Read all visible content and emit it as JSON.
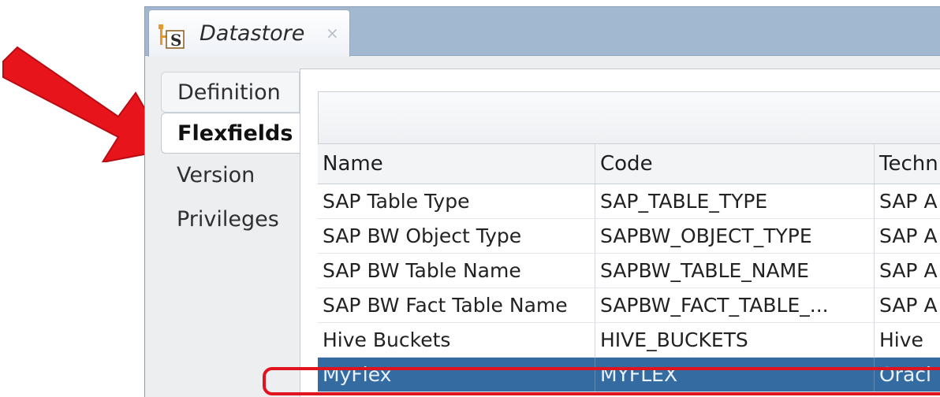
{
  "window": {
    "tab_title": "Datastore",
    "tab_close": "×",
    "tab_icon": "sap-datastore-icon"
  },
  "sections": {
    "items": [
      {
        "label": "Definition",
        "selected": false
      },
      {
        "label": "Flexfields",
        "selected": true
      },
      {
        "label": "Version",
        "selected": false
      },
      {
        "label": "Privileges",
        "selected": false
      }
    ]
  },
  "table": {
    "columns": [
      "Name",
      "Code",
      "Techn"
    ],
    "rows": [
      {
        "name": "SAP Table Type",
        "code": "SAP_TABLE_TYPE",
        "tech": "SAP A"
      },
      {
        "name": "SAP BW Object Type",
        "code": "SAPBW_OBJECT_TYPE",
        "tech": "SAP A"
      },
      {
        "name": "SAP BW Table Name",
        "code": "SAPBW_TABLE_NAME",
        "tech": "SAP A"
      },
      {
        "name": "SAP BW Fact Table Name",
        "code": "SAPBW_FACT_TABLE_...",
        "tech": "SAP A"
      },
      {
        "name": "Hive Buckets",
        "code": "HIVE_BUCKETS",
        "tech": "Hive"
      },
      {
        "name": "MyFlex",
        "code": "MYFLEX",
        "tech": "Oracl",
        "selected": true
      }
    ]
  },
  "colors": {
    "selection": "#346ba0",
    "annotation_red": "#e0141e",
    "tab_strip": "#a2b8d1"
  }
}
